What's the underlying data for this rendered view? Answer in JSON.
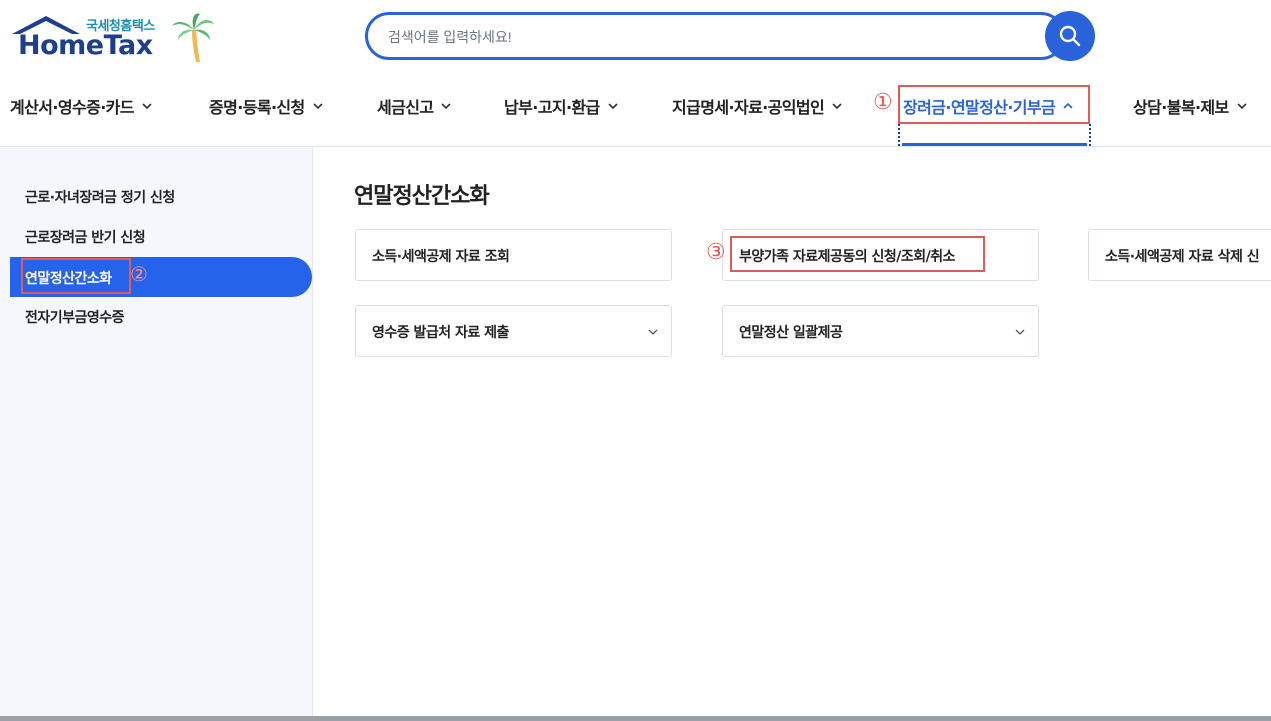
{
  "header": {
    "logo": {
      "sub": "국세청홈택스",
      "name": "HomeTax"
    },
    "search": {
      "placeholder": "검색어를 입력하세요!",
      "button_icon": "search-icon"
    }
  },
  "nav": {
    "items": [
      {
        "label": "계산서·영수증·카드"
      },
      {
        "label": "증명·등록·신청"
      },
      {
        "label": "세금신고"
      },
      {
        "label": "납부·고지·환급"
      },
      {
        "label": "지급명세·자료·공익법인"
      },
      {
        "label": "장려금·연말정산·기부금",
        "active": true
      },
      {
        "label": "상담·불복·제보"
      }
    ],
    "marker": "①"
  },
  "sidebar": {
    "items": [
      {
        "label": "근로·자녀장려금 정기 신청"
      },
      {
        "label": "근로장려금 반기 신청"
      },
      {
        "label": "연말정산간소화",
        "active": true
      },
      {
        "label": "전자기부금영수증"
      }
    ],
    "marker": "②"
  },
  "main": {
    "title": "연말정산간소화",
    "cards": [
      {
        "label": "소득·세액공제 자료 조회"
      },
      {
        "label": "부양가족 자료제공동의 신청/조회/취소"
      },
      {
        "label": "소득·세액공제 자료 삭제 신"
      },
      {
        "label": "영수증 발급처 자료 제출",
        "expandable": true
      },
      {
        "label": "연말정산 일괄제공",
        "expandable": true
      }
    ],
    "marker": "③"
  },
  "colors": {
    "accent": "#2962d9",
    "sidebar_active": "#2563eb",
    "highlight": "#e05a5a",
    "logo": "#1d3f8c"
  }
}
